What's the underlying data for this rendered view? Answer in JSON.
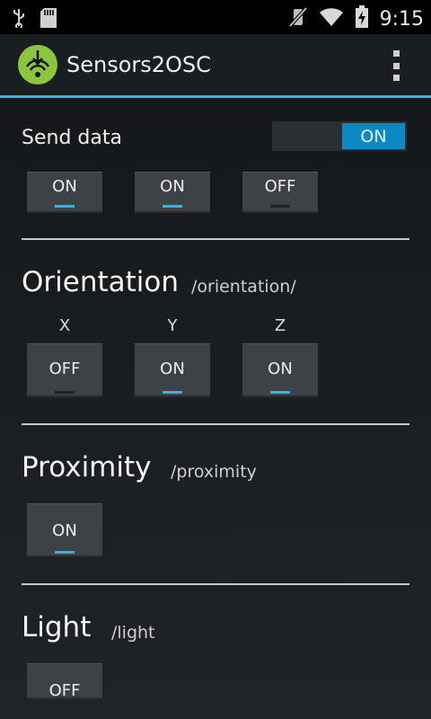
{
  "status_bar": {
    "time": "9:15",
    "icons": [
      "usb-icon",
      "sd-card-icon",
      "mute-icon",
      "wifi-icon",
      "battery-charging-icon"
    ]
  },
  "action_bar": {
    "title": "Sensors2OSC",
    "overflow_icon": "overflow-menu-icon"
  },
  "send_data": {
    "label": "Send data",
    "toggle": "ON"
  },
  "first_row_toggles": [
    "ON",
    "ON",
    "OFF"
  ],
  "orientation": {
    "title": "Orientation",
    "path": "/orientation/",
    "axes": [
      "X",
      "Y",
      "Z"
    ],
    "toggles": [
      "OFF",
      "ON",
      "ON"
    ]
  },
  "proximity": {
    "title": "Proximity",
    "path": "/proximity",
    "toggle": "ON"
  },
  "light": {
    "title": "Light",
    "path": "/light",
    "toggle": "OFF"
  },
  "colors": {
    "accent": "#33b5e5",
    "toggle_on": "#0e88c2",
    "logo_green": "#8cc63f"
  }
}
